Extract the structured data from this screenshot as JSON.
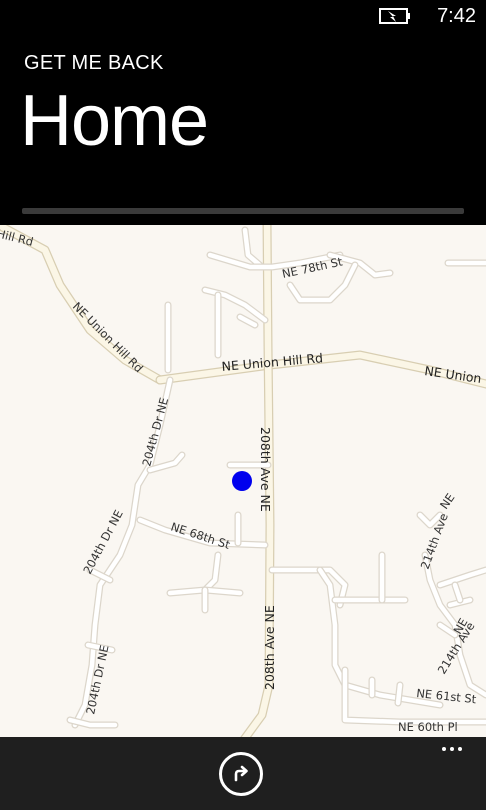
{
  "status_bar": {
    "time": "7:42",
    "battery_icon": "battery-charging-icon"
  },
  "header": {
    "app_title": "GET ME BACK",
    "page_title": "Home",
    "progress_percent": 0
  },
  "map": {
    "location_color": "#0000ee",
    "labels": {
      "hill_rd": "Hill Rd",
      "ne_union_hill_rd_diag": "NE Union Hill Rd",
      "ne_union_hill_rd": "NE Union Hill Rd",
      "ne_union": "NE Union",
      "ne_78th_st": "NE 78th St",
      "ave_208th_top": "208th Ave NE",
      "ave_208th_bottom": "208th Ave NE",
      "dr_204th_top": "204th Dr NE",
      "dr_204th_mid": "204th Dr NE",
      "dr_204th_bottom": "204th Dr NE",
      "ne_68th_st": "NE 68th St",
      "ave_214th": "214th Ave",
      "ne_right": "NE",
      "ne_right2": "NE",
      "ave_214th_b": "214th Ave",
      "ne_61st_st": "NE 61st St",
      "ne_60th_pl": "NE 60th Pl"
    }
  },
  "app_bar": {
    "primary_icon": "directions-icon",
    "more_icon": "more-icon"
  }
}
